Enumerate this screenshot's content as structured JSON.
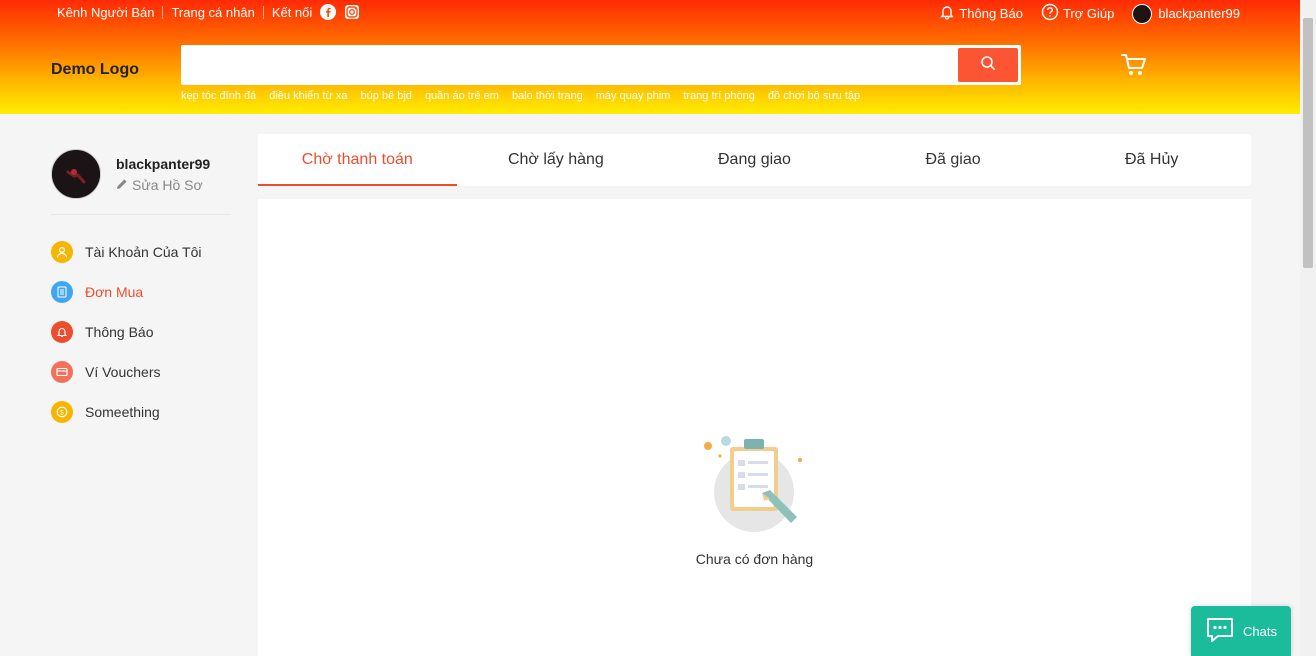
{
  "topbar": {
    "seller_channel": "Kênh Người Bán",
    "profile": "Trang cá nhân",
    "connect": "Kết nối",
    "notifications": "Thông Báo",
    "help": "Trợ Giúp",
    "username": "blackpanter99"
  },
  "header": {
    "logo": "Demo Logo",
    "search_placeholder": "",
    "keywords": [
      "kẹp tóc đính đá",
      "điều khiển từ xa",
      "búp bê bjd",
      "quần áo trẻ em",
      "balo thời trang",
      "máy quay phim",
      "trang trí phòng",
      "đồ chơi bộ sưu tập"
    ]
  },
  "sidebar": {
    "username": "blackpanter99",
    "edit_profile": "Sửa Hồ Sơ",
    "items": [
      {
        "label": "Tài Khoản Của Tôi",
        "icon": "user-icon",
        "color": "#f7b500"
      },
      {
        "label": "Đơn Mua",
        "icon": "document-icon",
        "color": "#3ea6f2"
      },
      {
        "label": "Thông Báo",
        "icon": "bell-icon",
        "color": "#ee4d2d"
      },
      {
        "label": "Ví Vouchers",
        "icon": "voucher-icon",
        "color": "#f2715a"
      },
      {
        "label": "Someething",
        "icon": "coin-icon",
        "color": "#f7b500"
      }
    ],
    "active_index": 1
  },
  "tabs": [
    "Chờ thanh toán",
    "Chờ lấy hàng",
    "Đang giao",
    "Đã giao",
    "Đã Hủy"
  ],
  "active_tab": 0,
  "empty_state": {
    "message": "Chưa có đơn hàng"
  },
  "chat": {
    "label": "Chats"
  },
  "colors": {
    "accent": "#ee4d2d",
    "chat": "#1abc9c"
  }
}
